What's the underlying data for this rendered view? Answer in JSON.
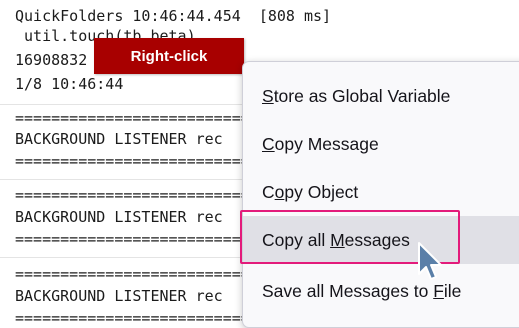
{
  "console": {
    "lines": [
      "QuickFolders 10:46:44.454  [808 ms]",
      " util.touch(tb_beta)",
      "16908832",
      "1/8 10:46:44",
      "================================================",
      "BACKGROUND LISTENER rec",
      "================================================",
      "================================================",
      "BACKGROUND LISTENER rec",
      "================================================",
      "================================================",
      "BACKGROUND LISTENER rec",
      "================================================"
    ]
  },
  "callout": {
    "label": "Right-click"
  },
  "context_menu": {
    "items": [
      {
        "before": "",
        "mnemonic": "S",
        "after": "tore as Global Variable"
      },
      {
        "before": "",
        "mnemonic": "C",
        "after": "opy Message"
      },
      {
        "before": "C",
        "mnemonic": "o",
        "after": "py Object"
      },
      {
        "before": "Copy all ",
        "mnemonic": "M",
        "after": "essages"
      },
      {
        "before": "Save all Messages to ",
        "mnemonic": "F",
        "after": "ile"
      }
    ],
    "hovered_index": 3
  },
  "colors": {
    "callout_bg": "#a80000",
    "highlight_border": "#e31b7b",
    "menu_bg": "#f9f9fb",
    "hover_bg": "#e0e0e6",
    "cursor_fill": "#5a7fa8"
  }
}
